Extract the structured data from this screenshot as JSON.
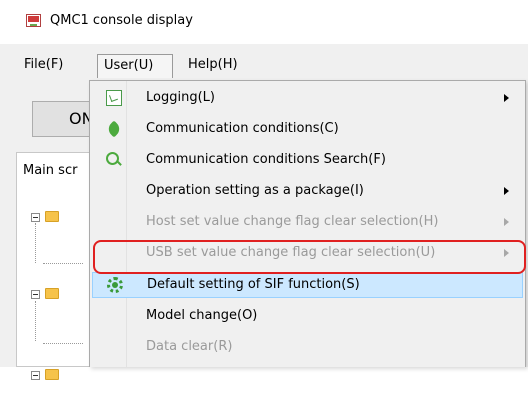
{
  "window": {
    "title": "QMC1 console display"
  },
  "menubar": {
    "file": "File(F)",
    "user": "User(U)",
    "help": "Help(H)"
  },
  "toolbar": {
    "on_label": "ON"
  },
  "main": {
    "tab_label": "Main scr"
  },
  "user_menu": {
    "items": [
      {
        "label": "Logging(L)",
        "icon": "logging-icon",
        "submenu": true,
        "enabled": true
      },
      {
        "label": "Communication conditions(C)",
        "icon": "communication-icon",
        "submenu": false,
        "enabled": true
      },
      {
        "label": "Communication conditions Search(F)",
        "icon": "search-icon",
        "submenu": false,
        "enabled": true
      },
      {
        "label": "Operation setting as a package(I)",
        "icon": "",
        "submenu": true,
        "enabled": true
      },
      {
        "label": "Host set value change flag clear selection(H)",
        "icon": "",
        "submenu": true,
        "enabled": false
      },
      {
        "label": "USB set value change flag clear selection(U)",
        "icon": "",
        "submenu": true,
        "enabled": false
      },
      {
        "label": "Default setting of SIF function(S)",
        "icon": "gear-icon",
        "submenu": false,
        "enabled": true,
        "selected": true
      },
      {
        "label": "Model change(O)",
        "icon": "",
        "submenu": false,
        "enabled": true
      },
      {
        "label": "Data clear(R)",
        "icon": "",
        "submenu": false,
        "enabled": false
      }
    ]
  },
  "colors": {
    "highlight_border": "#e02020",
    "selection_bg": "#cce8ff",
    "disabled_text": "#9a9a9a"
  }
}
